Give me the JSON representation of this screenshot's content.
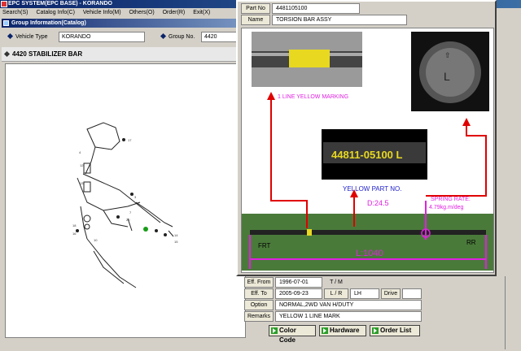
{
  "window": {
    "title": "EPC SYSTEM(EPC BASE) - KORANDO"
  },
  "menu": {
    "items": [
      "Search(S)",
      "Catalog Info(C)",
      "Vehicle Info(M)",
      "Others(O)",
      "Order(R)",
      "Exit(X)"
    ]
  },
  "group_info": {
    "header": "Group Information(Catalog)",
    "vehicle_type_label": "Vehicle Type",
    "vehicle_type_value": "KORANDO",
    "group_no_label": "Group No.",
    "group_no_value": "4420"
  },
  "catalog": {
    "title": "4420  STABILIZER BAR"
  },
  "part": {
    "part_no_label": "Part No",
    "part_no_value": "4481105100",
    "name_label": "Name",
    "name_value": "TORSION BAR ASSY"
  },
  "photo": {
    "yellow_marking": "1 LINE YELLOW MARKING",
    "part_number_text": "44811-05100 L",
    "yellow_part_no": "YELLOW PART NO.",
    "diameter": "D:24.5",
    "spring_rate_1": "SPRING RATE:",
    "spring_rate_2": "4.79kg.m/deg",
    "frt": "FRT",
    "rr": "RR",
    "length": "L:1040"
  },
  "details": {
    "eff_from_label": "Eff. From",
    "eff_from_value": "1996-07-01",
    "tm_label": "T / M",
    "eff_to_label": "Eff. To",
    "eff_to_value": "2005-09-23",
    "lr_label": "L / R",
    "lr_value": "LH",
    "drive_label": "Drive",
    "option_label": "Option",
    "option_value": "NORMAL,2WD VAN H/DUTY",
    "remarks_label": "Remarks",
    "remarks_value": "YELLOW 1 LINE MARK"
  },
  "buttons": {
    "color_code": "Color Code",
    "hardware": "Hardware",
    "order_list": "Order List"
  },
  "colors": {
    "accent": "#0a246a",
    "annotation": "#e020e0",
    "arrow": "#e00000"
  }
}
